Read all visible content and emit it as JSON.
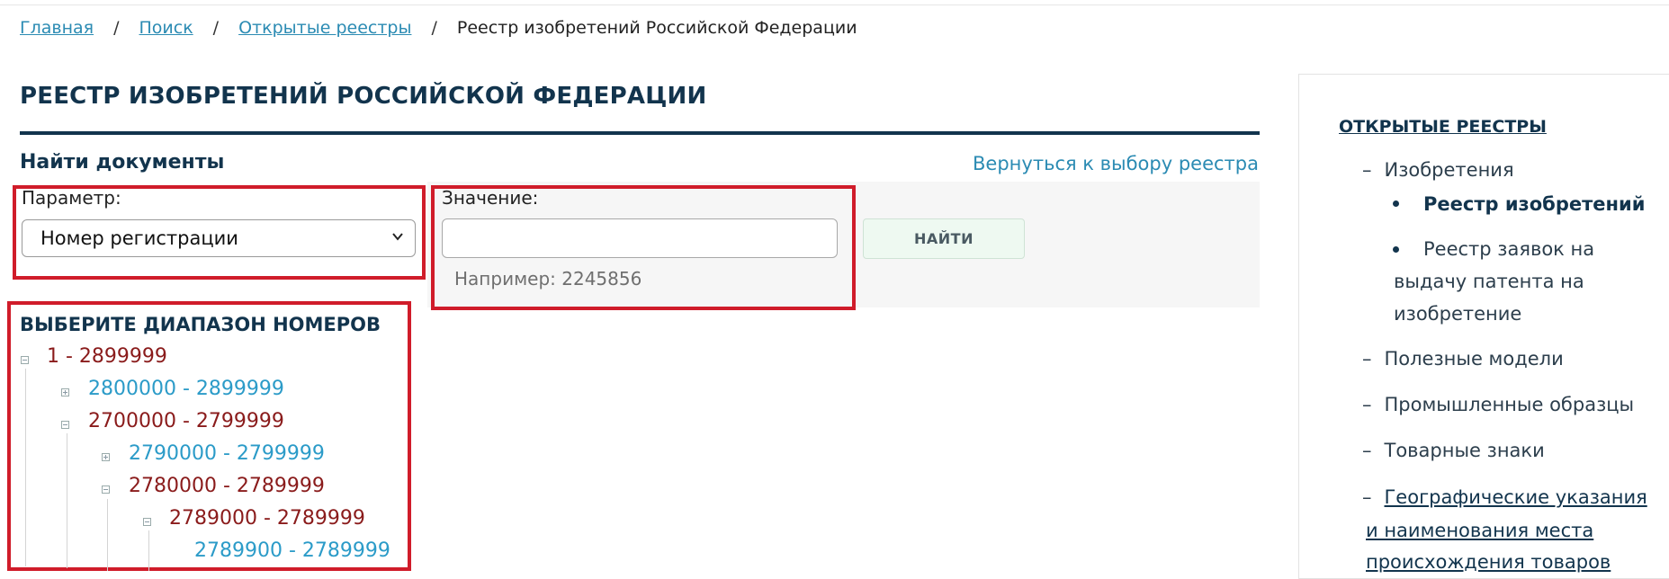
{
  "breadcrumb": {
    "items": [
      {
        "label": "Главная",
        "link": true
      },
      {
        "label": "Поиск",
        "link": true
      },
      {
        "label": "Открытые реестры",
        "link": true
      },
      {
        "label": "Реестр изобретений Российской Федерации",
        "link": false
      }
    ],
    "separator": "/"
  },
  "page": {
    "title": "РЕЕСТР ИЗОБРЕТЕНИЙ РОССИЙСКОЙ ФЕДЕРАЦИИ"
  },
  "search": {
    "heading": "Найти документы",
    "back_link": "Вернуться к выбору реестра",
    "parameter_label": "Параметр:",
    "parameter_value": "Номер регистрации",
    "value_label": "Значение:",
    "value_input": "",
    "hint": "Например: 2245856",
    "find_button": "НАЙТИ"
  },
  "range": {
    "title": "ВЫБЕРИТЕ ДИАПАЗОН НОМЕРОВ",
    "items": [
      {
        "label": "1 - 2899999",
        "expanded": true
      },
      {
        "label": "2800000 - 2899999",
        "expanded": false
      },
      {
        "label": "2700000 - 2799999",
        "expanded": true
      },
      {
        "label": "2790000 - 2799999",
        "expanded": false
      },
      {
        "label": "2780000 - 2789999",
        "expanded": true
      },
      {
        "label": "2789000 - 2789999",
        "expanded": true
      },
      {
        "label": "2789900 - 2789999",
        "expanded": false
      }
    ]
  },
  "sidebar": {
    "title": "ОТКРЫТЫЕ РЕЕСТРЫ",
    "dash": "–",
    "sections": [
      {
        "label": "Изобретения"
      },
      {
        "label": "Полезные модели"
      },
      {
        "label": "Промышленные образцы"
      },
      {
        "label": "Товарные знаки"
      }
    ],
    "sub_items": [
      {
        "label": "Реестр изобретений",
        "active": true
      },
      {
        "label_lines": [
          "Реестр заявок на",
          "выдачу патента на",
          "изобретение"
        ],
        "active": false
      }
    ],
    "geo_link_lines": [
      "Географические указания",
      "и наименования места",
      "происхождения товаров"
    ]
  },
  "colors": {
    "accent_dark": "#12344d",
    "link": "#2b8bb3",
    "tree_open": "#8a1b1b",
    "tree_closed": "#2b9bc8",
    "highlight_box": "#d01c2a"
  }
}
